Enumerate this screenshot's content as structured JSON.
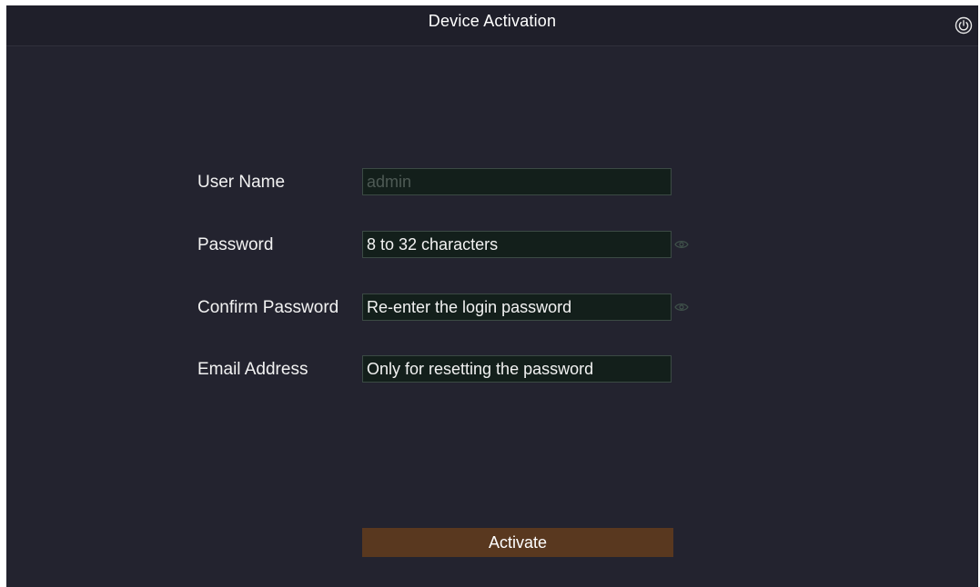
{
  "window": {
    "title": "Device Activation",
    "power_icon": "power-icon"
  },
  "form": {
    "user_name": {
      "label": "User Name",
      "value": "admin"
    },
    "password": {
      "label": "Password",
      "placeholder": "8 to 32 characters",
      "toggle_icon": "eye-icon"
    },
    "confirm_password": {
      "label": "Confirm Password",
      "placeholder": "Re-enter the login password",
      "toggle_icon": "eye-icon"
    },
    "email": {
      "label": "Email Address",
      "placeholder": "Only for resetting the password"
    }
  },
  "actions": {
    "activate_label": "Activate"
  },
  "colors": {
    "background": "#23232f",
    "field_background": "#131f1b",
    "button": "#59381f"
  }
}
